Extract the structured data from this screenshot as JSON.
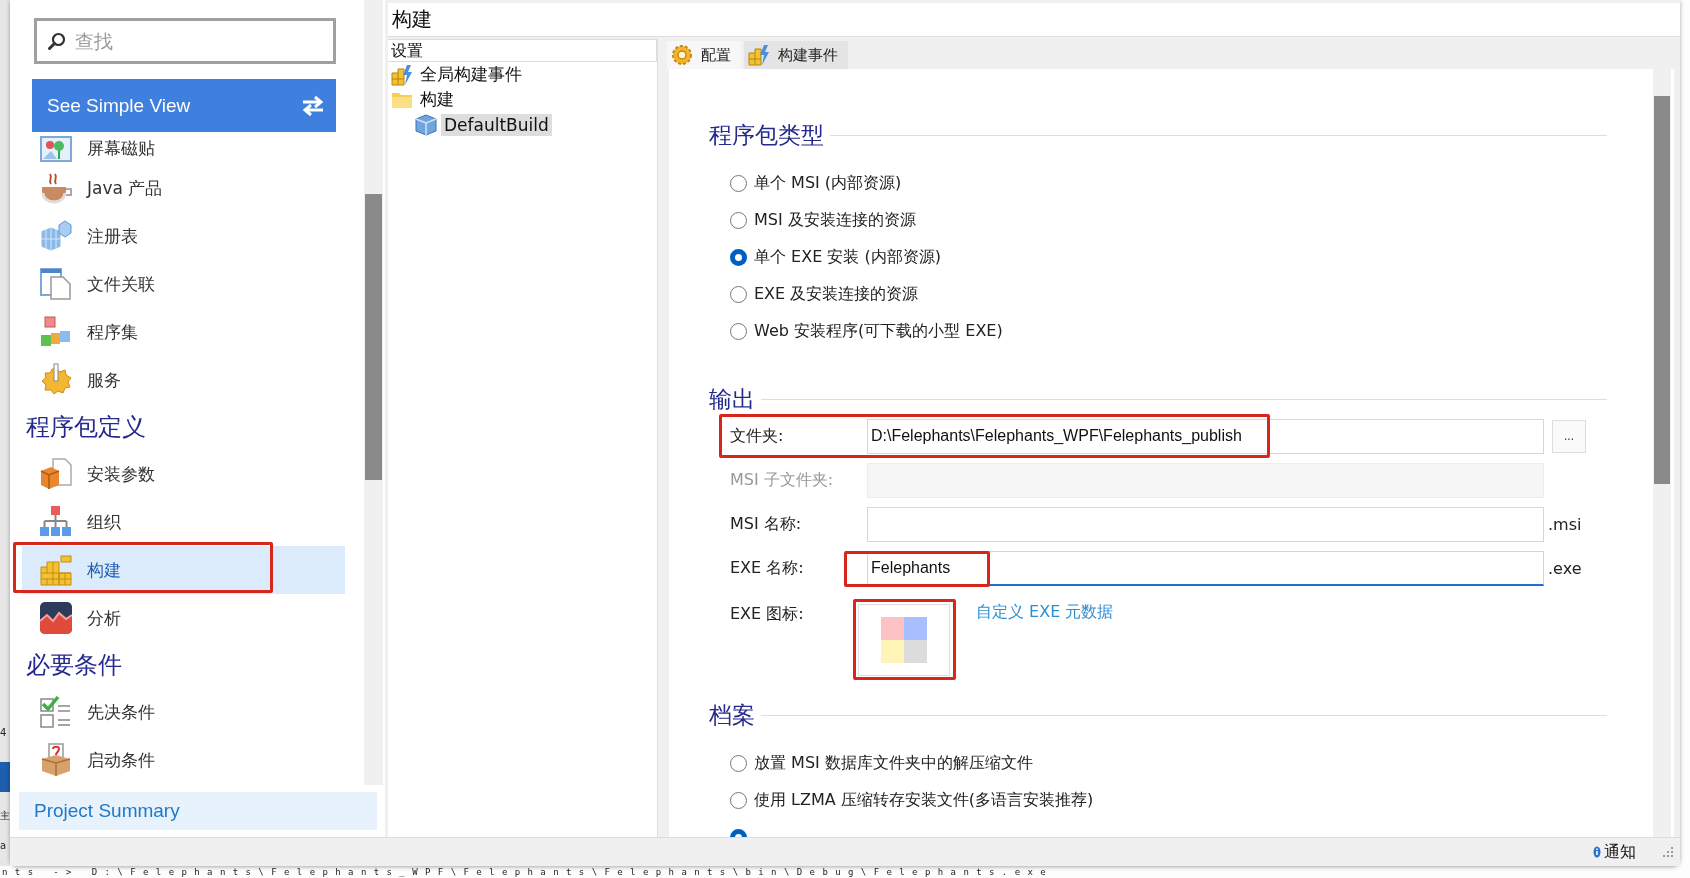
{
  "background_fragments": [
    "4",
    "主",
    "a"
  ],
  "sidebar": {
    "search": {
      "placeholder": "查找"
    },
    "simple_view_button": "See Simple View",
    "sections": [
      {
        "items": [
          {
            "label": "屏幕磁贴",
            "selected": false,
            "highlighted": false
          },
          {
            "label": "Java 产品",
            "selected": false,
            "highlighted": false
          },
          {
            "label": "注册表",
            "selected": false,
            "highlighted": false
          },
          {
            "label": "文件关联",
            "selected": false,
            "highlighted": false
          },
          {
            "label": "程序集",
            "selected": false,
            "highlighted": false
          },
          {
            "label": "服务",
            "selected": false,
            "highlighted": false
          }
        ]
      },
      {
        "title": "程序包定义",
        "items": [
          {
            "label": "安装参数",
            "selected": false,
            "highlighted": false
          },
          {
            "label": "组织",
            "selected": false,
            "highlighted": false
          },
          {
            "label": "构建",
            "selected": true,
            "highlighted": true
          },
          {
            "label": "分析",
            "selected": false,
            "highlighted": false
          }
        ]
      },
      {
        "title": "必要条件",
        "items": [
          {
            "label": "先决条件",
            "selected": false,
            "highlighted": false
          },
          {
            "label": "启动条件",
            "selected": false,
            "highlighted": false
          }
        ]
      }
    ],
    "summary_link": "Project Summary"
  },
  "page_title": "构建",
  "tree": {
    "header": "设置",
    "items": [
      {
        "label": "全局构建事件",
        "selected": false
      },
      {
        "label": "构建",
        "selected": false,
        "children": [
          {
            "label": "DefaultBuild",
            "selected": true
          }
        ]
      }
    ]
  },
  "tabs": [
    {
      "label": "配置",
      "selected": true
    },
    {
      "label": "构建事件",
      "selected": false
    }
  ],
  "package_type": {
    "title": "程序包类型",
    "options": [
      {
        "label": "单个 MSI (内部资源)",
        "selected": false
      },
      {
        "label": "MSI 及安装连接的资源",
        "selected": false
      },
      {
        "label": "单个 EXE 安装 (内部资源)",
        "selected": true
      },
      {
        "label": "EXE 及安装连接的资源",
        "selected": false
      },
      {
        "label": "Web 安装程序(可下载的小型 EXE)",
        "selected": false
      }
    ]
  },
  "output": {
    "title": "输出",
    "fields": [
      {
        "kind": "browse",
        "label": "文件夹:",
        "value": "D:\\Felephants\\Felephants_WPF\\Felephants_publish",
        "button": "...",
        "disabled": false,
        "focused": false,
        "highlighted": true
      },
      {
        "kind": "text",
        "label": "MSI 子文件夹:",
        "disabled": true,
        "focused": false,
        "highlighted": false
      },
      {
        "kind": "text",
        "label": "MSI 名称:",
        "suffix": ".msi",
        "disabled": false,
        "focused": false,
        "highlighted": false
      },
      {
        "kind": "text",
        "label": "EXE 名称:",
        "value": "Felephants",
        "suffix": ".exe",
        "disabled": false,
        "focused": true,
        "highlighted": true
      },
      {
        "kind": "icon",
        "label": "EXE 图标:",
        "link": "自定义 EXE 元数据",
        "highlighted": true
      }
    ]
  },
  "archive": {
    "title": "档案",
    "options": [
      {
        "label": "放置 MSI 数据库文件夹中的解压缩文件",
        "selected": false
      },
      {
        "label": "使用 LZMA 压缩转存安装文件(多语言安装推荐)",
        "selected": false
      },
      {
        "selected": true
      }
    ]
  },
  "status_bar": {
    "notification": "通知"
  },
  "terminal_line": "nts  -> D:\\Felephants\\Felephants_WPF\\Felephants\\Felephants\\bin\\Debug\\Felephants.exe"
}
